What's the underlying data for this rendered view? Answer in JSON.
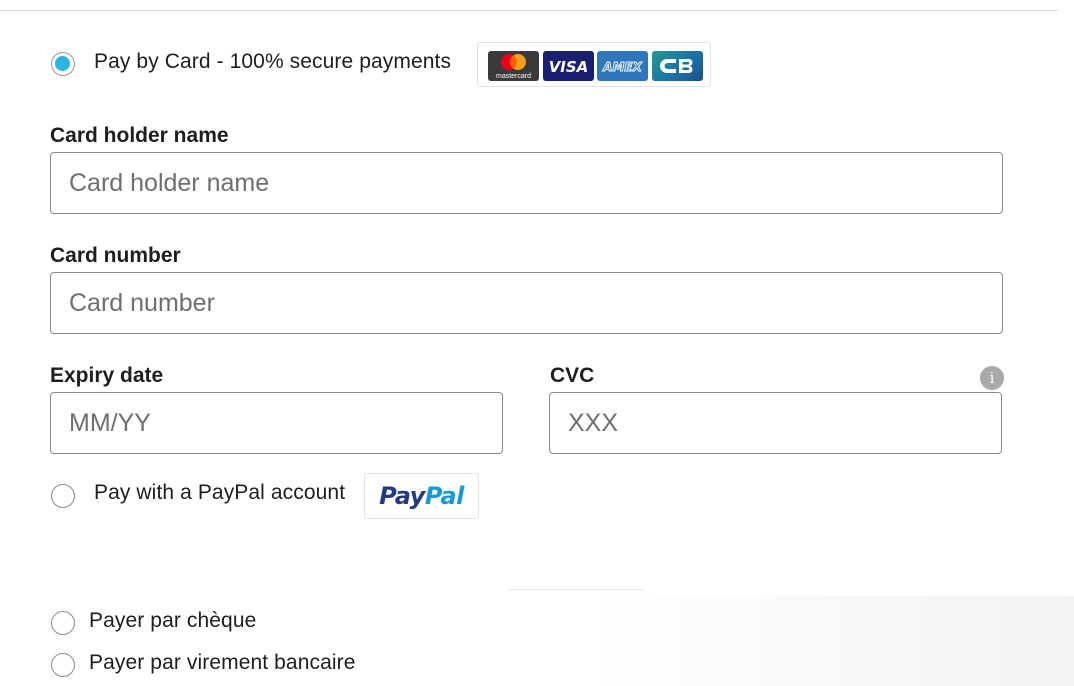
{
  "payment_options": {
    "card": {
      "label": "Pay by Card - 100% secure payments",
      "selected": true,
      "logos": {
        "mastercard_text": "mastercard",
        "visa_text": "VISA",
        "amex_text": "AMEX",
        "cb_text": "CB"
      }
    },
    "paypal": {
      "label": "Pay with a PayPal account",
      "selected": false,
      "logo_pay": "Pay",
      "logo_pal": "Pal"
    },
    "cheque": {
      "label": "Payer par chèque",
      "selected": false
    },
    "transfer": {
      "label": "Payer par virement bancaire",
      "selected": false
    }
  },
  "card_form": {
    "holder": {
      "label": "Card holder name",
      "placeholder": "Card holder name",
      "value": ""
    },
    "number": {
      "label": "Card number",
      "placeholder": "Card number",
      "value": ""
    },
    "expiry": {
      "label": "Expiry date",
      "placeholder": "MM/YY",
      "value": ""
    },
    "cvc": {
      "label": "CVC",
      "placeholder": "XXX",
      "value": "",
      "info_icon_glyph": "i"
    }
  },
  "colors": {
    "radio_selected": "#2ab4e3",
    "mastercard_red": "#eb001b",
    "mastercard_orange": "#f79e1b",
    "visa_blue": "#1a1f71",
    "amex_blue": "#2e77bc",
    "cb_teal": "#17a4a3",
    "paypal_dark": "#253b80",
    "paypal_light": "#179bd7"
  }
}
